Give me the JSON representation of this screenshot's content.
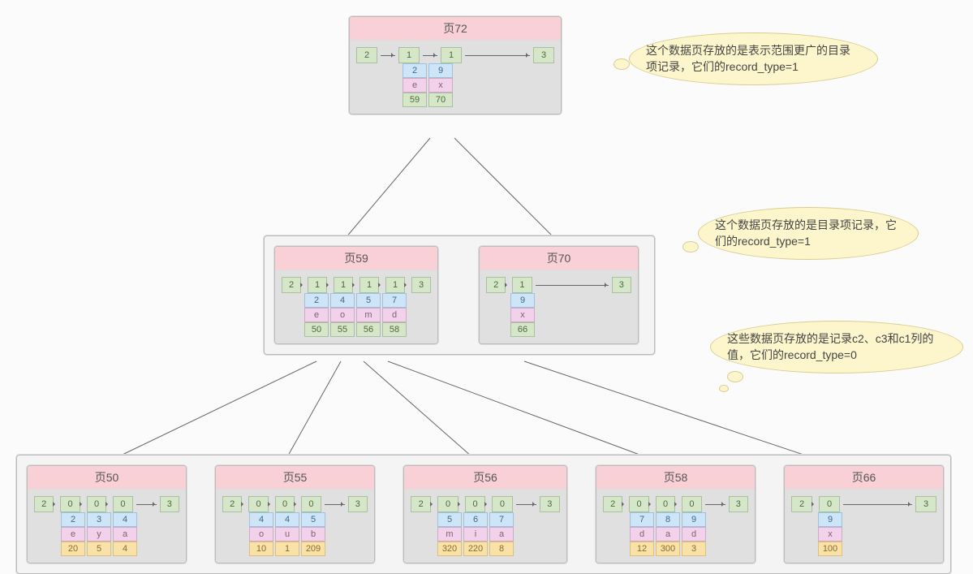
{
  "pages": {
    "p72": {
      "title": "页72",
      "slots": [
        "2",
        "1",
        "1",
        "3"
      ],
      "records": [
        [
          "2",
          "e",
          "59"
        ],
        [
          "9",
          "x",
          "70"
        ]
      ]
    },
    "p59": {
      "title": "页59",
      "slots": [
        "2",
        "1",
        "1",
        "1",
        "1",
        "3"
      ],
      "records": [
        [
          "2",
          "e",
          "50"
        ],
        [
          "4",
          "o",
          "55"
        ],
        [
          "5",
          "m",
          "56"
        ],
        [
          "7",
          "d",
          "58"
        ]
      ]
    },
    "p70": {
      "title": "页70",
      "slots": [
        "2",
        "1",
        "3"
      ],
      "records": [
        [
          "9",
          "x",
          "66"
        ]
      ]
    },
    "p50": {
      "title": "页50",
      "slots": [
        "2",
        "0",
        "0",
        "0",
        "3"
      ],
      "records": [
        [
          "2",
          "e",
          "20"
        ],
        [
          "3",
          "y",
          "5"
        ],
        [
          "4",
          "a",
          "4"
        ]
      ]
    },
    "p55": {
      "title": "页55",
      "slots": [
        "2",
        "0",
        "0",
        "0",
        "3"
      ],
      "records": [
        [
          "4",
          "o",
          "10"
        ],
        [
          "4",
          "u",
          "1"
        ],
        [
          "5",
          "b",
          "209"
        ]
      ]
    },
    "p56": {
      "title": "页56",
      "slots": [
        "2",
        "0",
        "0",
        "0",
        "3"
      ],
      "records": [
        [
          "5",
          "m",
          "320"
        ],
        [
          "6",
          "i",
          "220"
        ],
        [
          "7",
          "a",
          "8"
        ]
      ]
    },
    "p58": {
      "title": "页58",
      "slots": [
        "2",
        "0",
        "0",
        "0",
        "3"
      ],
      "records": [
        [
          "7",
          "d",
          "12"
        ],
        [
          "8",
          "a",
          "300"
        ],
        [
          "9",
          "d",
          "3"
        ]
      ]
    },
    "p66": {
      "title": "页66",
      "slots": [
        "2",
        "0",
        "3"
      ],
      "records": [
        [
          "9",
          "x",
          "100"
        ]
      ]
    }
  },
  "callouts": {
    "c1": "这个数据页存放的是表示范围更广的目录项记录，它们的record_type=1",
    "c2": "这个数据页存放的是目录项记录，它们的record_type=1",
    "c3": "这些数据页存放的是记录c2、c3和c1列的值，它们的record_type=0"
  }
}
